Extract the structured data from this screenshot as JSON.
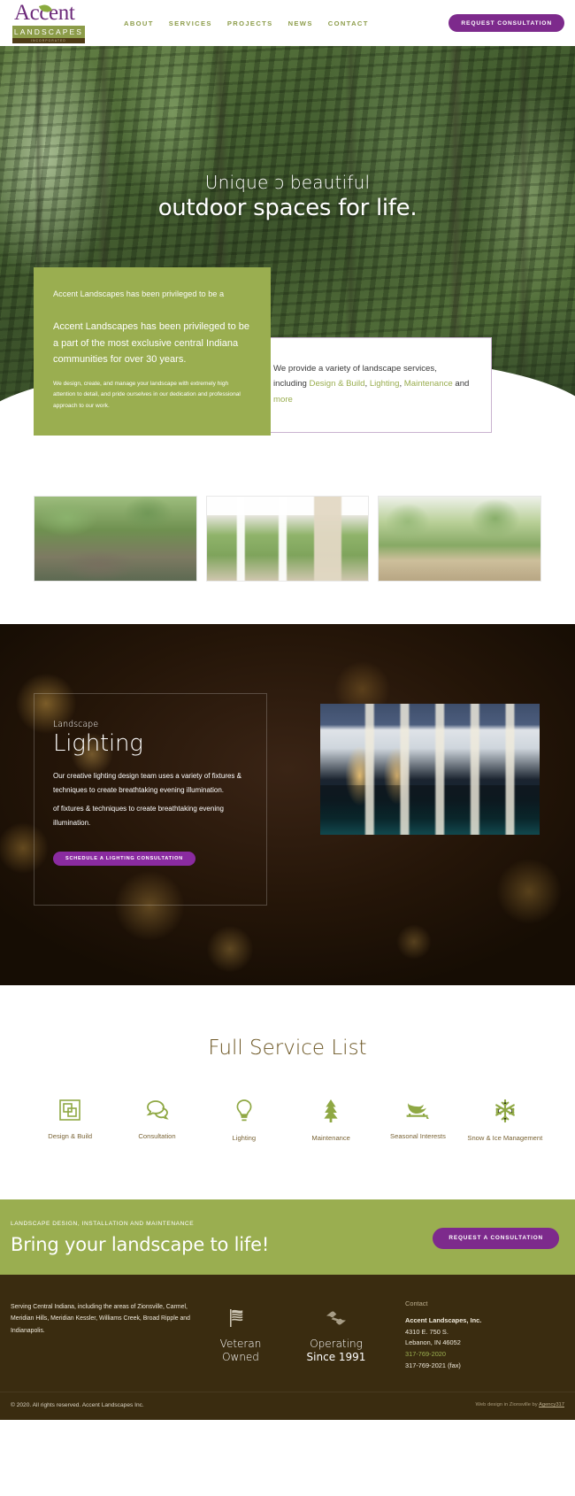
{
  "header": {
    "logo": {
      "word": "Accent",
      "bar_text": "LANDSCAPES",
      "sub_text": "INCORPORATED",
      "leaf_icon": "leaf-icon"
    },
    "nav": [
      {
        "label": "ABOUT"
      },
      {
        "label": "SERVICES"
      },
      {
        "label": "PROJECTS"
      },
      {
        "label": "NEWS"
      },
      {
        "label": "CONTACT"
      }
    ],
    "cta_label": "REQUEST CONSULTATION"
  },
  "hero": {
    "line1": "Unique ↄ beautiful",
    "line2": "outdoor spaces for life."
  },
  "intro": {
    "ghost_text": "Accent Landscapes has been privileged to be a",
    "lead": "Accent Landscapes has been privileged to be a part of the most exclusive central Indiana communities for over 30 years.",
    "body": "We design, create, and manage your landscape with extremely high attention to detail, and pride ourselves in our dedication and professional approach to our work.",
    "panel": {
      "text_1": "We provide a variety of landscape services, including ",
      "link_1": "Design & Build",
      "text_2": ", ",
      "link_2": "Lighting",
      "text_3": ", ",
      "link_3": "Maintenance",
      "text_4": " and ",
      "link_4": "more"
    }
  },
  "gallery": [
    {
      "alt": "water-feature-patio-photo"
    },
    {
      "alt": "pergola-outdoor-fireplace-photo"
    },
    {
      "alt": "stone-retaining-wall-photo"
    }
  ],
  "lighting": {
    "eyebrow": "Landscape",
    "title": "Lighting",
    "body": "Our creative lighting design team uses a variety of fixtures & techniques to create breathtaking evening illumination.",
    "body_ghost": "of fixtures & techniques to create breathtaking evening illumination.",
    "button_label": "SCHEDULE A LIGHTING CONSULTATION",
    "photo_alt": "illuminated-pergola-pool-night-photo"
  },
  "services": {
    "title": "Full Service List",
    "items": [
      {
        "label": "Design & Build",
        "icon": "design-build-icon"
      },
      {
        "label": "Consultation",
        "icon": "speech-bubbles-icon"
      },
      {
        "label": "Lighting",
        "icon": "lightbulb-icon"
      },
      {
        "label": "Maintenance",
        "icon": "evergreen-tree-icon"
      },
      {
        "label": "Seasonal Interests",
        "icon": "sleigh-icon"
      },
      {
        "label": "Snow & Ice Management",
        "icon": "snowflake-icon"
      }
    ]
  },
  "cta": {
    "eyebrow": "LANDSCAPE DESIGN, INSTALLATION AND MAINTENANCE",
    "title": "Bring your landscape to life!",
    "button_label": "REQUEST A CONSULTATION"
  },
  "footer": {
    "service_areas": "Serving Central Indiana, including the areas of Zionsville, Carmel, Meridian Hills, Meridian Kessler, Williams Creek, Broad Ripple and Indianapolis.",
    "badges": [
      {
        "icon": "american-flag-icon",
        "line1": "Veteran",
        "line2": "Owned"
      },
      {
        "icon": "handshake-icon",
        "line1": "Operating",
        "line2": "Since 1991"
      }
    ],
    "contact": {
      "heading": "Contact",
      "company": "Accent Landscapes, Inc.",
      "address_line1": "4310 E. 750 S.",
      "address_line2": "Lebanon, IN 46052",
      "phone": "317-769-2020",
      "fax": "317-769-2021 (fax)"
    },
    "copyright": "© 2020. All rights reserved. Accent Landscapes Inc.",
    "credit_prefix": "Web design in Zionsville by ",
    "credit_link": "Agency317"
  },
  "colors": {
    "brand_purple": "#7d2a8c",
    "brand_green": "#9aae50",
    "footer_brown": "#3a2c10",
    "service_label": "#7a6436"
  }
}
